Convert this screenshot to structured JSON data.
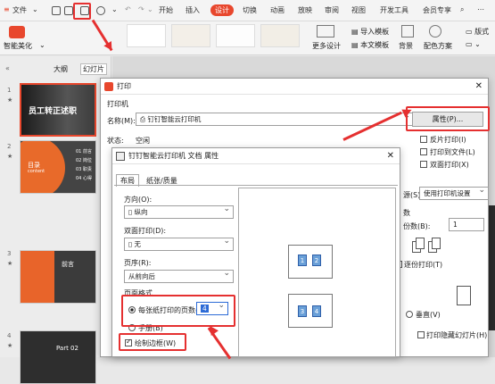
{
  "ribbon": {
    "menu_file": "文件",
    "tabs": [
      "开始",
      "插入",
      "设计",
      "切换",
      "动画",
      "放映",
      "审阅",
      "视图",
      "开发工具",
      "会员专享"
    ],
    "active_tab": "设计",
    "smart_beautify": "智能美化",
    "more_design": "更多设计",
    "import_template": "导入模板",
    "this_doc_template": "本文模板",
    "background": "背景",
    "color_scheme": "配色方案",
    "layout": "版式"
  },
  "panel": {
    "tab_outline": "大纲",
    "tab_slides": "幻灯片",
    "slide_numbers": [
      "1",
      "2",
      "3",
      "4"
    ],
    "slide1_title": "员工转正述职",
    "slide2_title": "目录",
    "slide2_sub": "content",
    "slide2_items": [
      "01 前言",
      "02 岗位",
      "03 职责",
      "04 心得"
    ],
    "slide3_title": "前言",
    "slide4_title": "Part 02"
  },
  "print_dialog": {
    "title": "打印",
    "section_printer": "打印机",
    "name_label": "名称(M):",
    "printer_name": "钉钉智能云打印机",
    "properties_button": "属性(P)...",
    "status_label": "状态:",
    "status_value": "空闲",
    "reverse_print": "反片打印(I)",
    "print_to_file": "打印到文件(L)",
    "duplex_print": "双面打印(X)",
    "paper_source_label": "源(S):",
    "paper_source_value": "使用打印机设置",
    "copies_section": "数",
    "copies_label": "份数(B):",
    "copies_value": "1",
    "collate_label": "逐份打印(T)",
    "vertical_label": "垂直(V)",
    "hidden_print": "打印隐藏幻灯片(H)"
  },
  "props_dialog": {
    "title": "钉钉智能云打印机 文档 属性",
    "tab_layout": "布局",
    "tab_paper": "纸张/质量",
    "orientation_label": "方向(O):",
    "orientation_value": "纵向",
    "duplex_label": "双面打印(D):",
    "duplex_value": "无",
    "page_order_label": "页序(R):",
    "page_order_value": "从前向后",
    "page_format_label": "页面格式",
    "pages_per_sheet_label": "每张纸打印的页数(S)",
    "pages_per_sheet_value": "4",
    "booklet_label": "手册(B)",
    "draw_borders_label": "绘制边框(W)",
    "preview_pages": [
      "1",
      "2",
      "3",
      "4"
    ]
  },
  "colors": {
    "accent": "#e8472d",
    "annotation": "#e53030"
  }
}
